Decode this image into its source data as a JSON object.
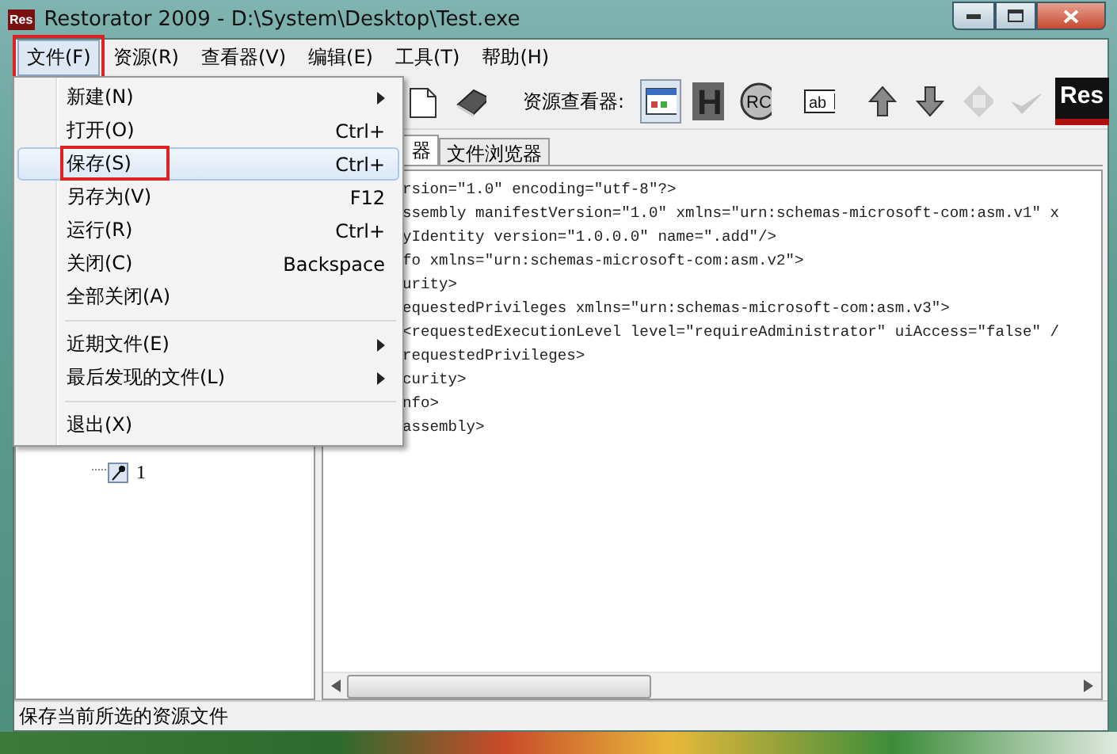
{
  "window": {
    "icon_text": "Res",
    "title": "Restorator 2009 - D:\\System\\Desktop\\Test.exe"
  },
  "menubar": [
    {
      "label": "文件(F)",
      "selected": true,
      "highlighted": true
    },
    {
      "label": "资源(R)",
      "selected": false,
      "highlighted": false
    },
    {
      "label": "查看器(V)",
      "selected": false,
      "highlighted": false
    },
    {
      "label": "编辑(E)",
      "selected": false,
      "highlighted": false
    },
    {
      "label": "工具(T)",
      "selected": false,
      "highlighted": false
    },
    {
      "label": "帮助(H)",
      "selected": false,
      "highlighted": false
    }
  ],
  "file_menu": [
    {
      "kind": "item",
      "label": "新建(N)",
      "submenu": true,
      "selected": false,
      "highlighted": false
    },
    {
      "kind": "item",
      "label": "打开(O)",
      "shortcut": "Ctrl+",
      "submenu": false,
      "selected": false,
      "highlighted": false
    },
    {
      "kind": "item",
      "label": "保存(S)",
      "shortcut": "Ctrl+",
      "submenu": false,
      "selected": true,
      "highlighted": true
    },
    {
      "kind": "item",
      "label": "另存为(V)",
      "shortcut": "F12",
      "submenu": false,
      "selected": false,
      "highlighted": false
    },
    {
      "kind": "item",
      "label": "运行(R)",
      "shortcut": "Ctrl+",
      "submenu": false,
      "selected": false,
      "highlighted": false
    },
    {
      "kind": "item",
      "label": "关闭(C)",
      "shortcut": "Backspace",
      "submenu": false,
      "selected": false,
      "highlighted": false
    },
    {
      "kind": "item",
      "label": "全部关闭(A)",
      "submenu": false,
      "selected": false,
      "highlighted": false
    },
    {
      "kind": "separator"
    },
    {
      "kind": "item",
      "label": "近期文件(E)",
      "submenu": true,
      "selected": false,
      "highlighted": false
    },
    {
      "kind": "item",
      "label": "最后发现的文件(L)",
      "submenu": true,
      "selected": false,
      "highlighted": false
    },
    {
      "kind": "separator"
    },
    {
      "kind": "item",
      "label": "退出(X)",
      "submenu": false,
      "selected": false,
      "highlighted": false
    }
  ],
  "toolbar": [
    {
      "kind": "page",
      "pressed": false,
      "disabled": false
    },
    {
      "kind": "book",
      "pressed": false,
      "disabled": false
    },
    {
      "kind": "separator"
    },
    {
      "kind": "label",
      "text": "资源查看器:"
    },
    {
      "kind": "dialog",
      "pressed": true,
      "disabled": false
    },
    {
      "kind": "letter",
      "text": "H",
      "pressed": false,
      "disabled": false
    },
    {
      "kind": "circle",
      "text": "RC",
      "pressed": false,
      "disabled": false
    },
    {
      "kind": "separator"
    },
    {
      "kind": "textbox",
      "text": "ab",
      "pressed": false,
      "disabled": false
    },
    {
      "kind": "separator"
    },
    {
      "kind": "up",
      "pressed": false,
      "disabled": false
    },
    {
      "kind": "down",
      "pressed": false,
      "disabled": false
    },
    {
      "kind": "diamond",
      "pressed": false,
      "disabled": true
    },
    {
      "kind": "check",
      "pressed": false,
      "disabled": true
    },
    {
      "kind": "logo",
      "text": "Res"
    }
  ],
  "tree": [
    {
      "label": "1"
    }
  ],
  "tabs": [
    {
      "label": "器",
      "selected": true
    },
    {
      "label": "文件浏览器",
      "selected": false
    }
  ],
  "code_lines": [
    "rsion=\"1.0\" encoding=\"utf-8\"?>",
    "ssembly manifestVersion=\"1.0\" xmlns=\"urn:schemas-microsoft-com:asm.v1\" x",
    "yIdentity version=\"1.0.0.0\" name=\".add\"/>",
    "fo xmlns=\"urn:schemas-microsoft-com:asm.v2\">",
    "urity>",
    "equestedPrivileges xmlns=\"urn:schemas-microsoft-com:asm.v3\">",
    "<requestedExecutionLevel level=\"requireAdministrator\" uiAccess=\"false\" /",
    "requestedPrivileges>",
    "curity>",
    "nfo>",
    "assembly>"
  ],
  "status_bar": "保存当前所选的资源文件"
}
